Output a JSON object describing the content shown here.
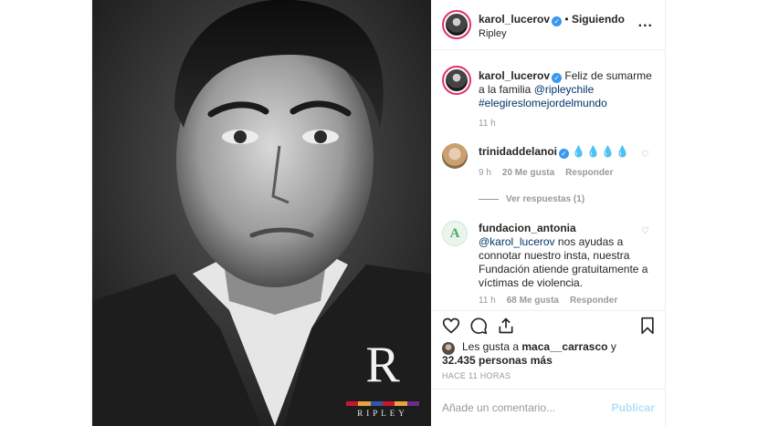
{
  "header": {
    "username": "karol_lucerov",
    "separator": "•",
    "follow_status": "Siguiendo",
    "location": "Ripley",
    "more_label": "..."
  },
  "caption": {
    "username": "karol_lucerov",
    "text_1": "Feliz de sumarme a la familia",
    "mention": "@ripleychile",
    "hashtag": "#elegireslomejordelmundo",
    "time": "11 h"
  },
  "comments": [
    {
      "username": "trinidaddelanoi",
      "text": "💧💧💧💧",
      "time": "9 h",
      "likes": "20 Me gusta",
      "reply": "Responder"
    },
    {
      "username": "fundacion_antonia",
      "mention": "@karol_lucerov",
      "text": "nos ayudas a connotar nuestro insta, nuestra Fundación atiende gratuitamente a víctimas de violencia.",
      "time": "11 h",
      "likes": "68 Me gusta",
      "reply": "Responder"
    }
  ],
  "view_replies": "Ver respuestas (1)",
  "likes": {
    "prefix": "Les gusta a",
    "user": "maca__carrasco",
    "mid": "y",
    "count": "32.435 personas más"
  },
  "time_ago": "HACE 11 HORAS",
  "add_comment": {
    "placeholder": "Añade un comentario...",
    "post_label": "Publicar"
  },
  "brand": {
    "letter": "R",
    "name": "RIPLEY",
    "bar_colors": [
      "#c4182d",
      "#e8a33d",
      "#2d5aa8",
      "#c4182d",
      "#e8a33d",
      "#6b2d8a"
    ]
  },
  "colors": {
    "verified": "#3897f0",
    "link": "#003569",
    "muted": "#999999",
    "post_disabled": "#b2dffc"
  }
}
